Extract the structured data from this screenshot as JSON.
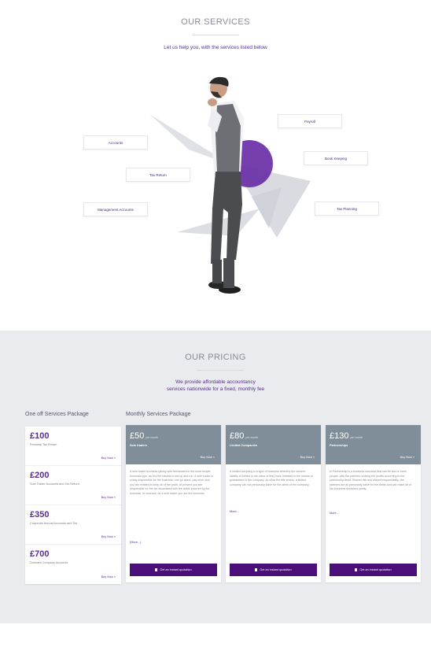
{
  "services": {
    "title": "OUR SERVICES",
    "subtitle": "Let us help you, with the services listed below",
    "labels": [
      "Accounts",
      "Tax Return",
      "Management Accounts",
      "Payroll",
      "Book Keeping",
      "Tax Planning"
    ]
  },
  "pricing": {
    "title": "OUR PRICING",
    "subtitle_line1": "We provide affordable accountancy",
    "subtitle_line2": "services nationwide for a fixed, monthly fee",
    "oneoff_heading": "One off Services Package",
    "monthly_heading": "Monthly Services Package",
    "oneoff": [
      {
        "price": "£100",
        "desc": "Personal Tax Return",
        "buy": "Buy Now »"
      },
      {
        "price": "£200",
        "desc": "Sole Trader Accounts and Tax Return",
        "buy": "Buy Now »"
      },
      {
        "price": "£350",
        "desc": "Corporate Annual Accounts and Tax",
        "buy": "Buy Now »"
      },
      {
        "price": "£700",
        "desc": "Dormant Company Accounts",
        "buy": "Buy Now »"
      }
    ],
    "monthly": [
      {
        "price": "£50",
        "per": "per month",
        "name": "Sole traders",
        "buy": "Buy Now »",
        "text": "A sole trader business (along with freelancers in the most simple business type, as it is the easiest to set up and run. A sole trader is solely responsible for the business, can go alone, pay more and you are entitled to keep all of the profit. At present you are responsible for the tax associated with the debts incurred by the business. In essence, as a sole trader you are the business.",
        "more": "(More...)",
        "cta": "Get an instant quotation"
      },
      {
        "price": "£80",
        "per": "per month",
        "name": "Limited Companies",
        "buy": "Buy Now »",
        "text": "A limited company is a type of business whereby the owners' liability is limited to the value of they have invested in the shares or guaranteed to the company. As what the title shows, a limited company can not personally liable for the debts of the company.",
        "more": "More...",
        "cta": "Get an instant quotation"
      },
      {
        "price": "£130",
        "per": "per month",
        "name": "Partnerships",
        "buy": "Buy Now »",
        "text": "In Partnership is a business structure that can be two or more people, with the partners sharing the profits according to the partnership deed. Shared risk and shared responsibility; the partners are all personally liable for the debts and can make all of the business decisions jointly.",
        "more": "More...",
        "cta": "Get an instant quotation"
      }
    ]
  },
  "colors": {
    "accent": "#5a2d91",
    "button": "#4b0f7a",
    "card_header": "#7f8e98",
    "pricing_bg": "#e9ebee"
  }
}
